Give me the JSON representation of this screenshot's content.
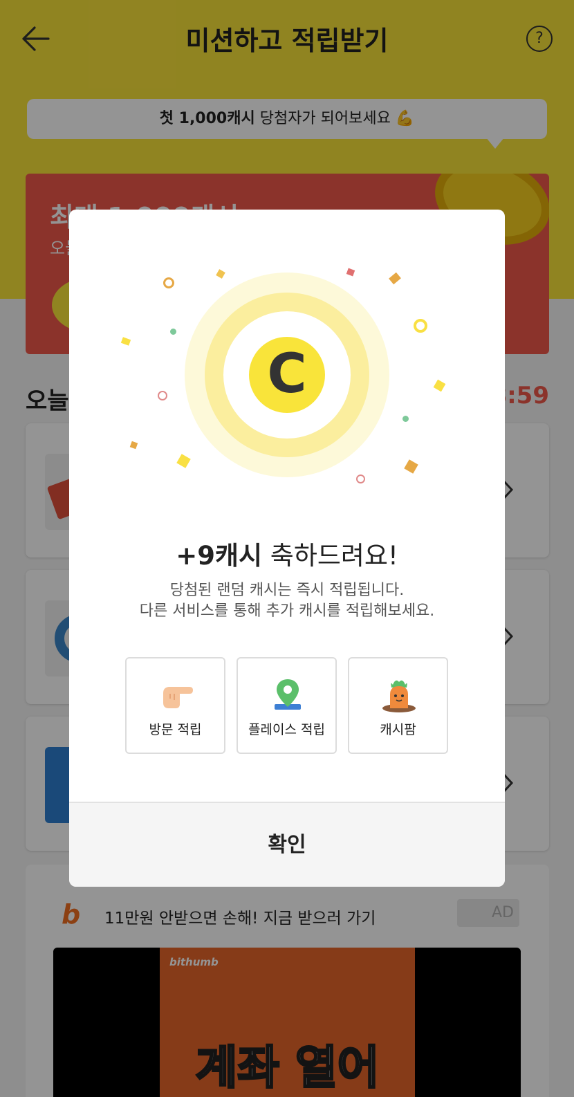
{
  "header": {
    "title": "미션하고 적립받기",
    "help_icon": "?"
  },
  "promo_bubble": {
    "bold_text": "첫 1,000캐시",
    "text": "당첨자가 되어보세요 💪"
  },
  "banner": {
    "title": "최대 1,000캐시",
    "subtitle": "오늘"
  },
  "section": {
    "title": "오늘",
    "timer": "8:59"
  },
  "ad": {
    "logo": "b",
    "text": "11만원 안받으면 손해! 지금 받으러 가기",
    "badge": "AD",
    "video_brand": "bithumb",
    "video_headline": "계좌 열어"
  },
  "modal": {
    "coin_letter": "C",
    "reward_bold": "+9캐시",
    "reward_text": " 축하드려요!",
    "desc_line1": "당첨된 랜덤 캐시는 즉시 적립됩니다.",
    "desc_line2": "다른 서비스를 통해 추가 캐시를 적립해보세요.",
    "services": [
      {
        "label": "방문 적립",
        "icon": "pointing-hand-icon"
      },
      {
        "label": "플레이스 적립",
        "icon": "map-pin-icon"
      },
      {
        "label": "캐시팜",
        "icon": "carrot-icon"
      }
    ],
    "confirm_label": "확인"
  },
  "colors": {
    "brand_yellow": "#f9e43a",
    "banner_red": "#f0584a",
    "dim_overlay": "rgba(0,0,0,0.42)"
  }
}
